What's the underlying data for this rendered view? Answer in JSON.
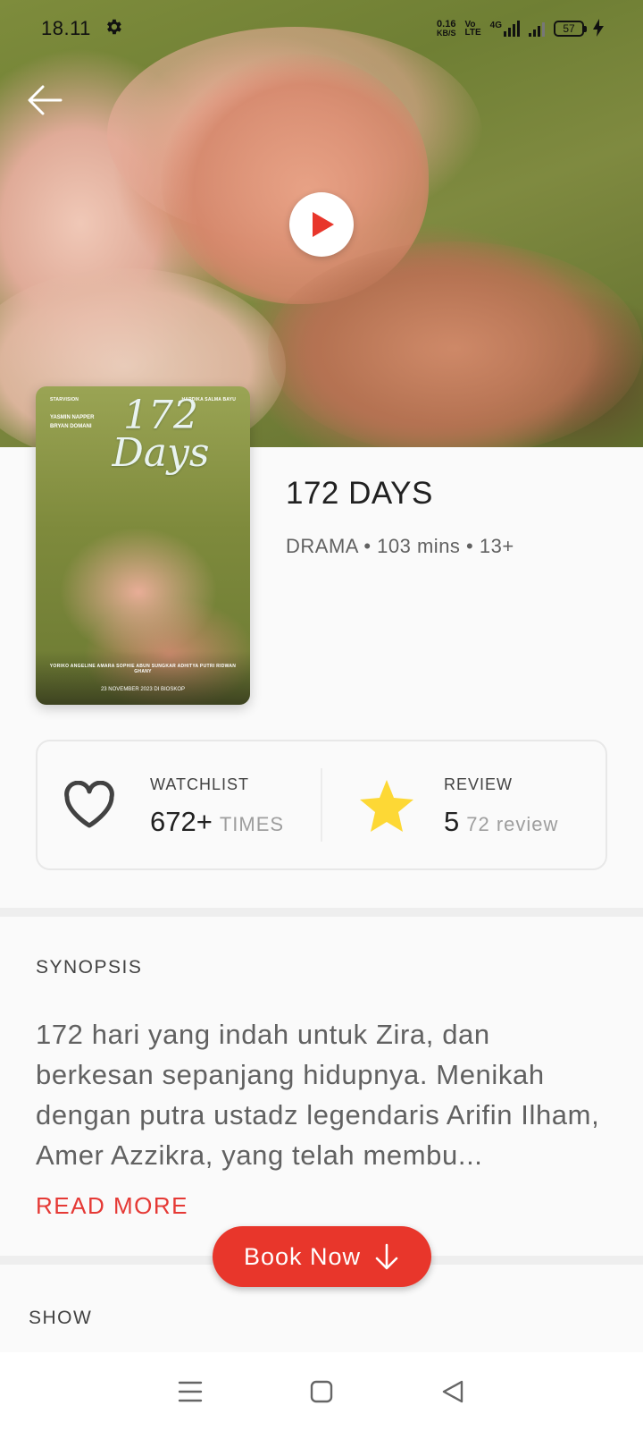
{
  "status_bar": {
    "time": "18.11",
    "net_speed_value": "0.16",
    "net_speed_unit": "KB/S",
    "volte_top": "Vo",
    "volte_bottom": "LTE",
    "network_type": "4G",
    "battery_level": "57"
  },
  "poster": {
    "studio": "STARVISION",
    "production": "HARDIKA SALMA BAYU",
    "lead_1": "YASMIN NAPPER",
    "lead_2": "BRYAN DOMANI",
    "title_line_1": "172",
    "title_line_2": "Days",
    "cast": "YORIKO ANGELINE   AMARA SOPHIE   ABUN SUNGKAR   ADHITYA PUTRI   RIDWAN GHANY",
    "release": "23 NOVEMBER 2023 DI BIOSKOP"
  },
  "movie": {
    "title": "172 DAYS",
    "meta": "DRAMA • 103 mins • 13+"
  },
  "stats": {
    "watchlist_label": "WATCHLIST",
    "watchlist_count": "672+",
    "watchlist_unit": "TIMES",
    "review_label": "REVIEW",
    "review_score": "5",
    "review_count": "72 review"
  },
  "synopsis": {
    "heading": "SYNOPSIS",
    "text": "172 hari yang indah untuk Zira, dan berkesan sepanjang hidupnya. Menikah dengan putra ustadz legendaris Arifin Ilham, Amer Azzikra, yang telah membu...",
    "read_more": "READ MORE"
  },
  "book_button": {
    "label": "Book Now"
  },
  "show": {
    "heading": "SHOW"
  },
  "colors": {
    "accent": "#e8362b",
    "read_more": "#e53935",
    "star": "#fdd835"
  },
  "icons": [
    "settings-gear-icon",
    "back-arrow-icon",
    "play-icon",
    "heart-icon",
    "star-icon",
    "arrow-down-icon",
    "menu-icon",
    "home-icon",
    "back-triangle-icon"
  ]
}
